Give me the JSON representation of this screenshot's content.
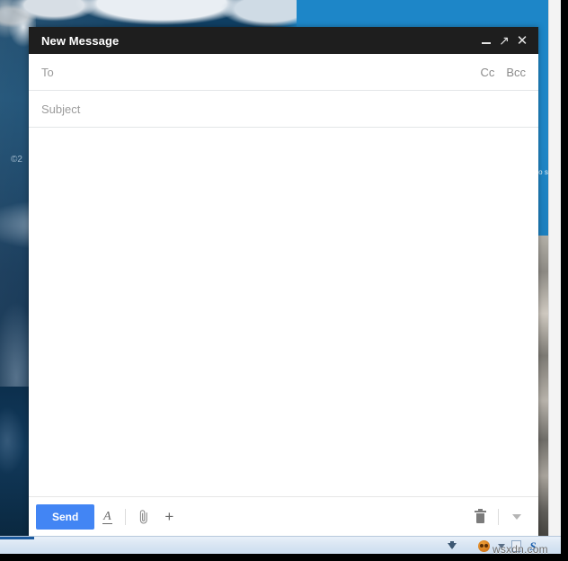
{
  "desktop": {
    "wallpaper_copyright": "©2",
    "right_strip_text": "o s",
    "watermark": "wsxdn.com",
    "taskbar": {
      "icons": [
        {
          "name": "download-icon",
          "label": "↓"
        },
        {
          "name": "monkey-icon",
          "label": ""
        },
        {
          "name": "caret-down-icon",
          "label": ""
        },
        {
          "name": "document-icon",
          "label": ""
        },
        {
          "name": "skype-s-icon",
          "label": "S"
        }
      ]
    }
  },
  "compose": {
    "title": "New Message",
    "window_controls": {
      "minimize": "minimize-icon",
      "expand": "↗",
      "close": "✕"
    },
    "to": {
      "placeholder": "To",
      "value": ""
    },
    "cc_label": "Cc",
    "bcc_label": "Bcc",
    "subject": {
      "placeholder": "Subject",
      "value": ""
    },
    "body": {
      "value": "",
      "placeholder": ""
    },
    "toolbar": {
      "send_label": "Send",
      "format_label": "A",
      "attach_label": "📎",
      "insert_label": "+",
      "discard_label": "discard",
      "more_options_label": "more"
    },
    "colors": {
      "send_blue": "#4285f4",
      "header_dark": "#1e1e1e",
      "placeholder_gray": "#9b9b9b"
    }
  }
}
